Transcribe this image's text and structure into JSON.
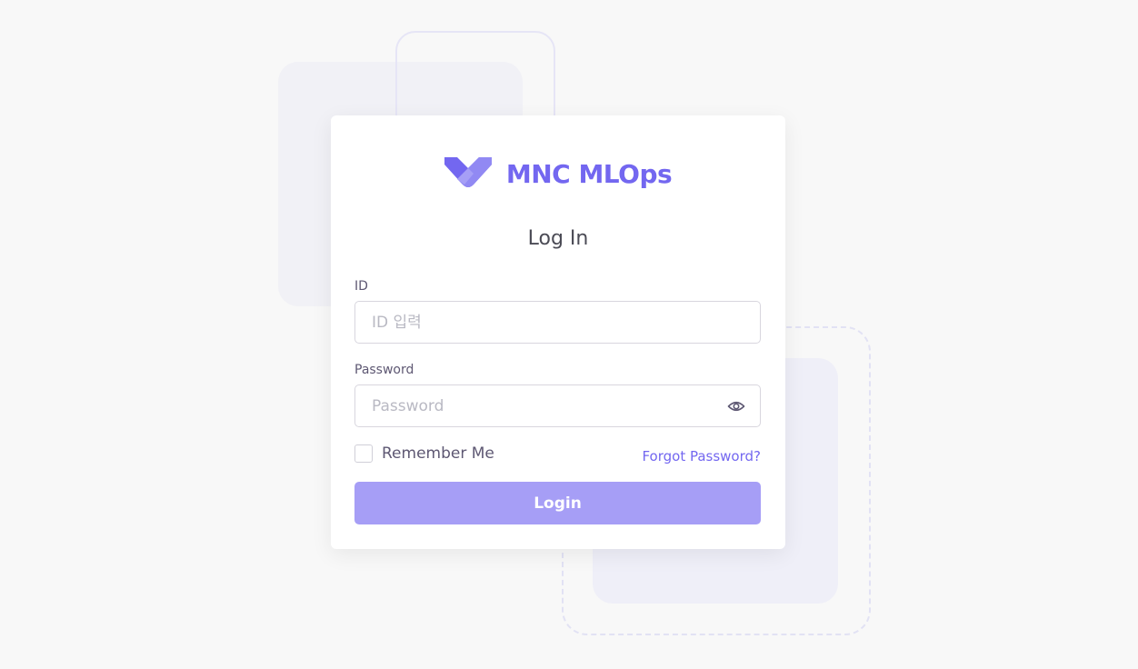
{
  "brand": {
    "name": "MNC MLOps",
    "logo_icon": "mnc-v-logo-icon",
    "accent_color": "#7367f0"
  },
  "login": {
    "title": "Log In",
    "id_label": "ID",
    "id_placeholder": "ID 입력",
    "id_value": "",
    "password_label": "Password",
    "password_placeholder": "Password",
    "password_value": "",
    "password_toggle_icon": "eye-icon",
    "remember_label": "Remember Me",
    "remember_checked": false,
    "forgot_label": "Forgot Password?",
    "submit_label": "Login",
    "submit_color": "#a69ef6"
  }
}
